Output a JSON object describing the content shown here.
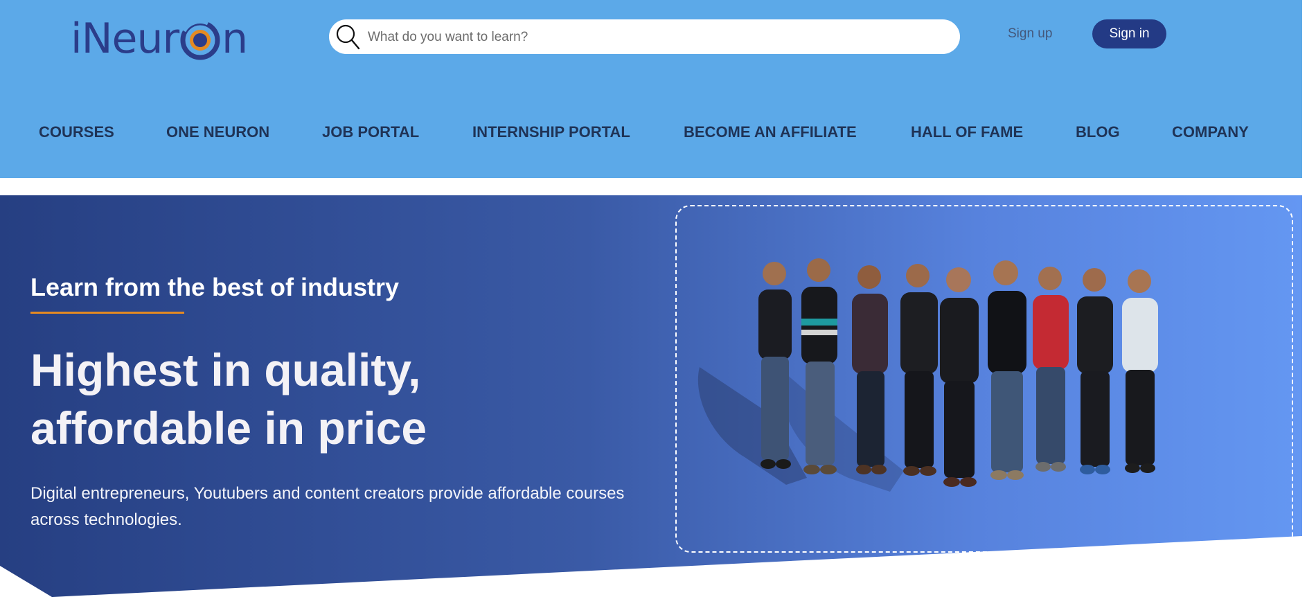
{
  "brand": {
    "logo_text_before": "iNeur",
    "logo_text_after": "n",
    "accent": "#e58a22",
    "primary": "#233a85",
    "header_bg": "#5ca9e8"
  },
  "search": {
    "placeholder": "What do you want to learn?",
    "icon": "search-icon"
  },
  "auth": {
    "signup_label": "Sign up",
    "signin_label": "Sign in"
  },
  "nav": {
    "items": [
      {
        "label": "COURSES"
      },
      {
        "label": "ONE NEURON"
      },
      {
        "label": "JOB PORTAL"
      },
      {
        "label": "INTERNSHIP PORTAL"
      },
      {
        "label": "BECOME AN AFFILIATE"
      },
      {
        "label": "HALL OF FAME"
      },
      {
        "label": "BLOG"
      },
      {
        "label": "COMPANY"
      }
    ]
  },
  "hero": {
    "eyebrow": "Learn from the best of industry",
    "headline": "Highest in quality, affordable in price",
    "subtext": "Digital entrepreneurs, Youtubers and content creators provide affordable courses across technologies.",
    "image": "team-photo"
  }
}
